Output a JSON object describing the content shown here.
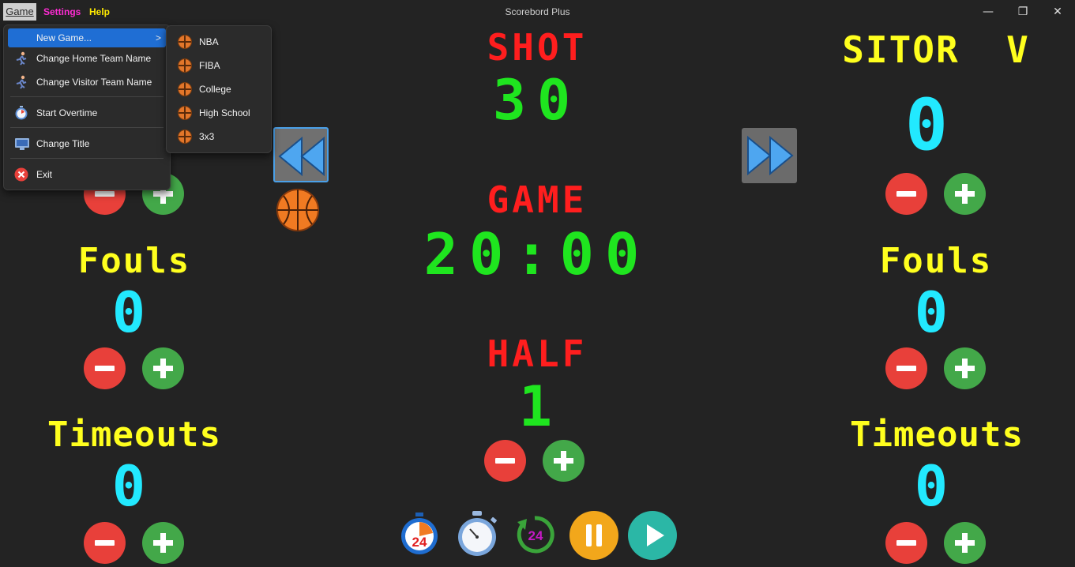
{
  "window": {
    "title": "Scorebord Plus"
  },
  "menubar": {
    "game": "Game",
    "settings": "Settings",
    "help": "Help"
  },
  "window_controls": {
    "minimize": "—",
    "restore": "❐",
    "close": "✕"
  },
  "game_menu": {
    "items": [
      {
        "label": "New Game...",
        "icon": "blank",
        "has_submenu": true,
        "selected": true
      },
      {
        "label": "Change Home Team Name",
        "icon": "runner-icon"
      },
      {
        "label": "Change Visitor Team Name",
        "icon": "runner-icon"
      },
      {
        "label": "Start Overtime",
        "icon": "stopwatch-icon"
      },
      {
        "label": "Change Title",
        "icon": "monitor-icon"
      },
      {
        "label": "Exit",
        "icon": "close-circle-icon"
      }
    ],
    "chevron": ">"
  },
  "new_game_submenu": {
    "items": [
      {
        "label": "NBA",
        "icon": "basketball-icon"
      },
      {
        "label": "FIBA",
        "icon": "basketball-icon"
      },
      {
        "label": "College",
        "icon": "basketball-icon"
      },
      {
        "label": "High School",
        "icon": "basketball-icon"
      },
      {
        "label": "3x3",
        "icon": "basketball-icon"
      }
    ]
  },
  "center": {
    "shot_label": "SHOT",
    "shot_value": "30",
    "game_label": "GAME",
    "game_value": "20:00",
    "half_label": "HALF",
    "half_value": "1"
  },
  "home": {
    "fouls_label": "Fouls",
    "fouls_value": "0",
    "timeouts_label": "Timeouts",
    "timeouts_value": "0"
  },
  "visitor": {
    "name": "SITOR  V",
    "score": "0",
    "fouls_label": "Fouls",
    "fouls_value": "0",
    "timeouts_label": "Timeouts",
    "timeouts_value": "0"
  },
  "controls": {
    "shot24_label": "24",
    "reset24_label": "24"
  },
  "colors": {
    "background": "#232323",
    "led_red": "#ff1e1e",
    "led_green": "#1fe51f",
    "led_yellow": "#ffff1e",
    "led_cyan": "#22e9ff",
    "minus_button": "#e8403a",
    "plus_button": "#43a849",
    "menu_highlight": "#1f6ed4"
  }
}
